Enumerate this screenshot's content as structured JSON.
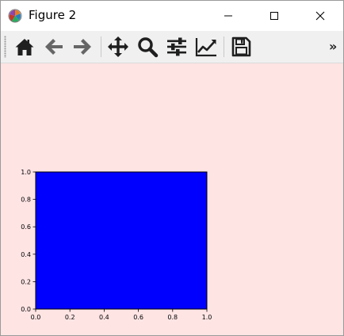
{
  "window": {
    "title": "Figure 2",
    "app_icon": "matplotlib-icon",
    "controls": [
      "minimize-icon",
      "maximize-icon",
      "close-icon"
    ]
  },
  "toolbar": {
    "buttons": [
      {
        "name": "home-button",
        "icon": "home-icon",
        "tooltip": "Reset original view"
      },
      {
        "name": "back-button",
        "icon": "arrow-left-icon",
        "tooltip": "Back to previous view"
      },
      {
        "name": "forward-button",
        "icon": "arrow-right-icon",
        "tooltip": "Forward to next view"
      },
      {
        "name": "pan-button",
        "icon": "move-icon",
        "tooltip": "Pan axes"
      },
      {
        "name": "zoom-button",
        "icon": "magnifier-icon",
        "tooltip": "Zoom to rectangle"
      },
      {
        "name": "subplots-button",
        "icon": "sliders-icon",
        "tooltip": "Configure subplots"
      },
      {
        "name": "customize-button",
        "icon": "line-chart-icon",
        "tooltip": "Edit axis, curve and image parameters"
      },
      {
        "name": "save-button",
        "icon": "floppy-disk-icon",
        "tooltip": "Save the figure"
      }
    ],
    "overflow_label": "»"
  },
  "colors": {
    "figure_background": "#ffe4e4",
    "axes_face": "#0000ff",
    "toolbar_background": "#f0f0f0",
    "icon_dark": "#1f1f1f",
    "icon_gray": "#666666"
  },
  "chart_data": {
    "type": "area",
    "title": "",
    "xlabel": "",
    "ylabel": "",
    "xlim": [
      0.0,
      1.0
    ],
    "ylim": [
      0.0,
      1.0
    ],
    "x_ticks": [
      0.0,
      0.2,
      0.4,
      0.6,
      0.8,
      1.0
    ],
    "y_ticks": [
      0.0,
      0.2,
      0.4,
      0.6,
      0.8,
      1.0
    ],
    "x_tick_labels": [
      "0.0",
      "0.2",
      "0.4",
      "0.6",
      "0.8",
      "1.0"
    ],
    "y_tick_labels": [
      "0.0",
      "0.2",
      "0.4",
      "0.6",
      "0.8",
      "1.0"
    ],
    "grid": false,
    "legend": null,
    "axes_facecolor": "#0000ff",
    "series": []
  }
}
